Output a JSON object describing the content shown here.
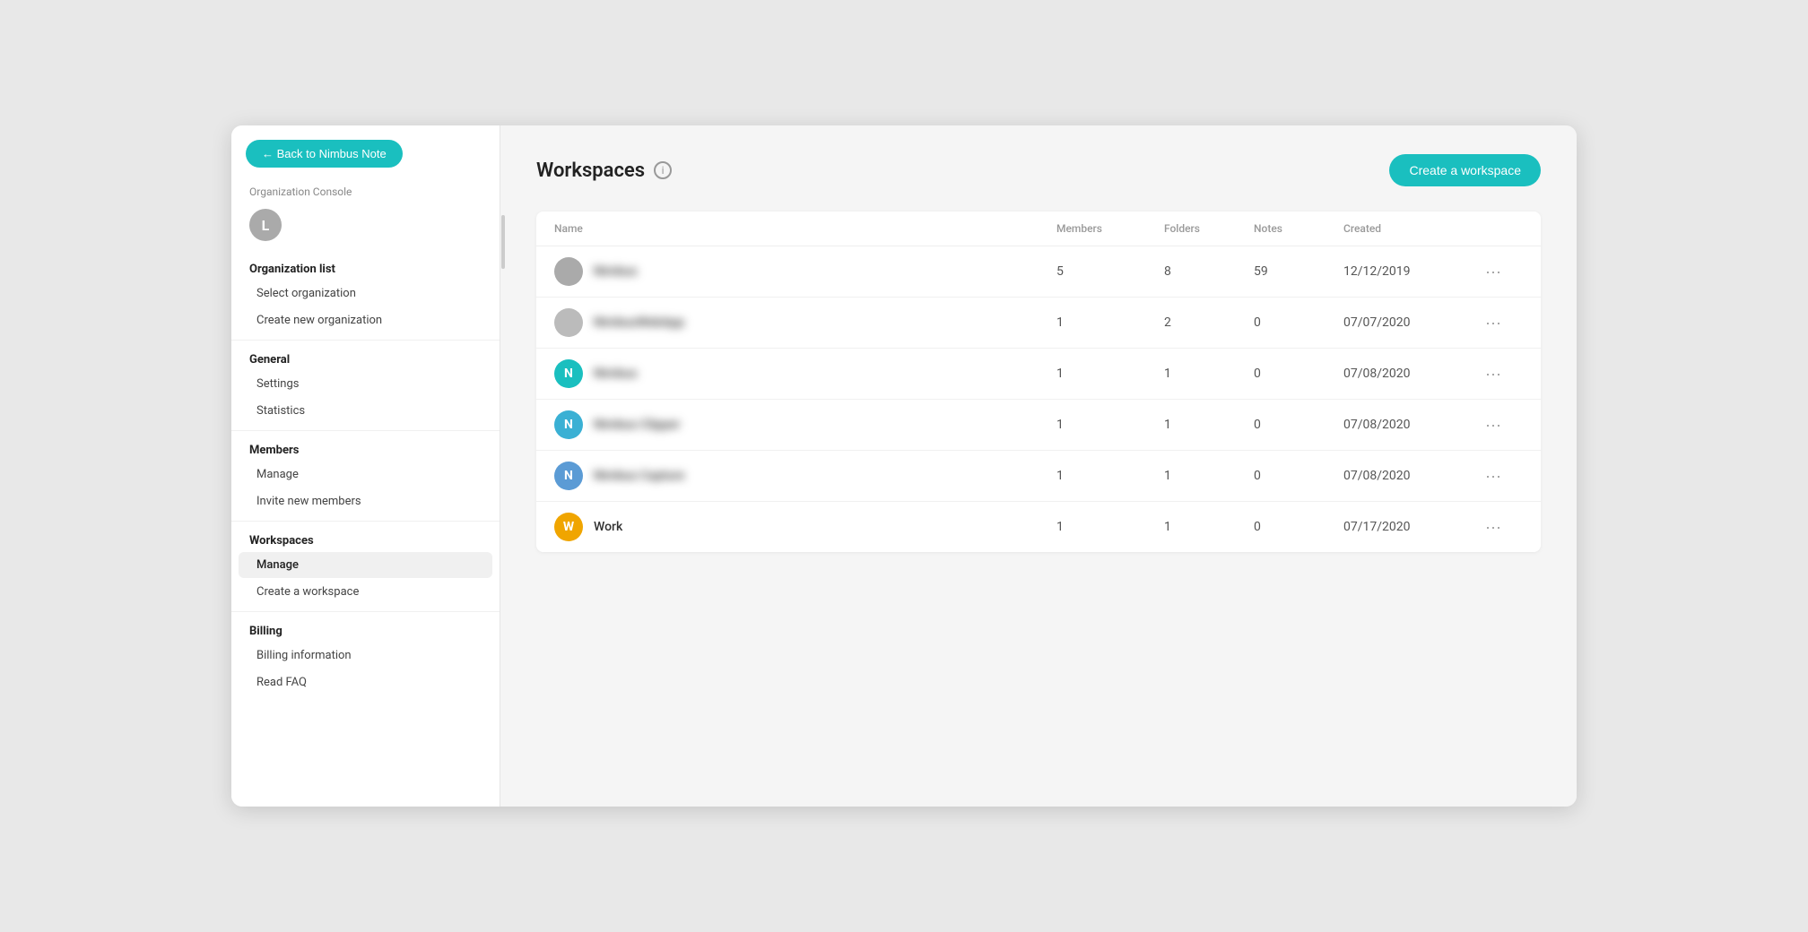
{
  "back_button": "← Back to Nimbus Note",
  "sidebar": {
    "org_console_label": "Organization Console",
    "org_avatar_letter": "L",
    "sections": [
      {
        "title": "Organization list",
        "items": [
          {
            "id": "select-org",
            "label": "Select organization",
            "active": false
          },
          {
            "id": "create-new-org",
            "label": "Create new organization",
            "active": false
          }
        ]
      },
      {
        "title": "General",
        "items": [
          {
            "id": "settings",
            "label": "Settings",
            "active": false
          },
          {
            "id": "statistics",
            "label": "Statistics",
            "active": false
          }
        ]
      },
      {
        "title": "Members",
        "items": [
          {
            "id": "members-manage",
            "label": "Manage",
            "active": false
          },
          {
            "id": "invite-members",
            "label": "Invite new members",
            "active": false
          }
        ]
      },
      {
        "title": "Workspaces",
        "items": [
          {
            "id": "workspaces-manage",
            "label": "Manage",
            "active": true
          },
          {
            "id": "create-workspace",
            "label": "Create a workspace",
            "active": false
          }
        ]
      },
      {
        "title": "Billing",
        "items": [
          {
            "id": "billing-info",
            "label": "Billing information",
            "active": false
          },
          {
            "id": "read-faq",
            "label": "Read FAQ",
            "active": false
          }
        ]
      }
    ]
  },
  "main": {
    "title": "Workspaces",
    "create_button": "Create a workspace",
    "table": {
      "headers": [
        "Name",
        "Members",
        "Folders",
        "Notes",
        "Created",
        ""
      ],
      "rows": [
        {
          "id": 1,
          "name": "Nimbus",
          "blurred": true,
          "avatar_bg": "#aaa",
          "avatar_letter": "",
          "members": 5,
          "folders": 8,
          "notes": 59,
          "created": "12/12/2019"
        },
        {
          "id": 2,
          "name": "NimbusWebApp",
          "blurred": true,
          "avatar_bg": "#bbb",
          "avatar_letter": "",
          "members": 1,
          "folders": 2,
          "notes": 0,
          "created": "07/07/2020"
        },
        {
          "id": 3,
          "name": "Nimbus",
          "blurred": true,
          "avatar_bg": "#1abfbf",
          "avatar_letter": "N",
          "members": 1,
          "folders": 1,
          "notes": 0,
          "created": "07/08/2020"
        },
        {
          "id": 4,
          "name": "Nimbus Clipper",
          "blurred": true,
          "avatar_bg": "#3ab0d4",
          "avatar_letter": "N",
          "members": 1,
          "folders": 1,
          "notes": 0,
          "created": "07/08/2020"
        },
        {
          "id": 5,
          "name": "Nimbus Capture",
          "blurred": true,
          "avatar_bg": "#5b9bd5",
          "avatar_letter": "N",
          "members": 1,
          "folders": 1,
          "notes": 0,
          "created": "07/08/2020"
        },
        {
          "id": 6,
          "name": "Work",
          "blurred": false,
          "avatar_bg": "#f0a500",
          "avatar_letter": "W",
          "members": 1,
          "folders": 1,
          "notes": 0,
          "created": "07/17/2020"
        }
      ]
    }
  }
}
